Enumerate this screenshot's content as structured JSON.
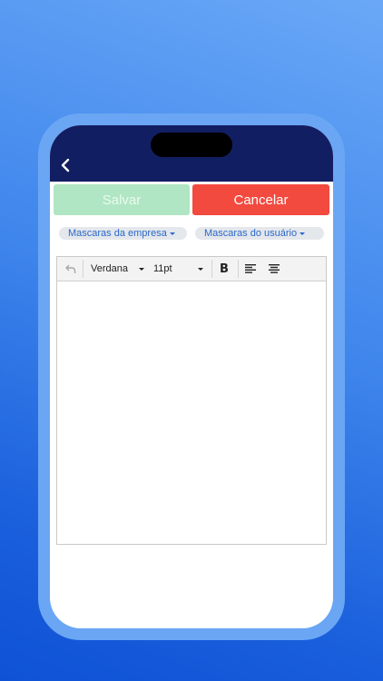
{
  "form": {
    "save_label": "Salvar",
    "cancel_label": "Cancelar"
  },
  "masks": {
    "company_label": "Mascaras da empresa",
    "user_label": "Mascaras do usuário"
  },
  "editor": {
    "toolbar": {
      "font_family": "Verdana",
      "font_size": "11pt"
    },
    "content": ""
  },
  "colors": {
    "navbar": "#121e62",
    "save_button": "#b0e6c3",
    "cancel_button": "#f24a3f",
    "link_text": "#2a68c8"
  },
  "icons": {
    "back": "chevron-left-icon",
    "undo": "undo-icon",
    "bold": "bold-icon",
    "align_left": "align-left-icon",
    "align_center": "align-center-icon"
  }
}
